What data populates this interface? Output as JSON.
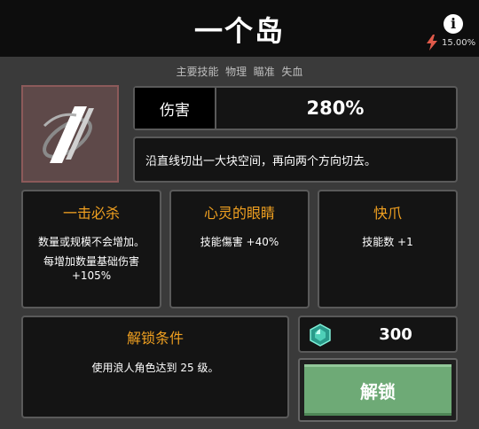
{
  "header": {
    "title": "一个岛",
    "info_icon": "info-icon",
    "drop_rate": "15.00%",
    "drop_rate_icon": "lightning-bolt-icon"
  },
  "tags": "主要技能  物理  瞄准  失血",
  "skill": {
    "icon": "slash-skill-icon",
    "damage_label": "伤害",
    "damage_value": "280%",
    "description": "沿直线切出一大块空间，再向两个方向切去。"
  },
  "traits": [
    {
      "title": "一击必杀",
      "desc_line1": "数量或规模不会增加。",
      "desc_line2": "每增加数量基础伤害",
      "desc_line3": "+105%"
    },
    {
      "title": "心灵的眼睛",
      "desc_line1": "技能傷害 +40%"
    },
    {
      "title": "快爪",
      "desc_line1": "技能数 +1"
    }
  ],
  "unlock": {
    "title": "解锁条件",
    "desc": "使用浪人角色达到 25 级。",
    "cost": "300",
    "cost_icon": "gem-icon",
    "button_label": "解锁"
  },
  "colors": {
    "accent": "#f0a020",
    "button_green": "#6eaa76",
    "background": "#3a3a3a",
    "panel": "#141414"
  }
}
